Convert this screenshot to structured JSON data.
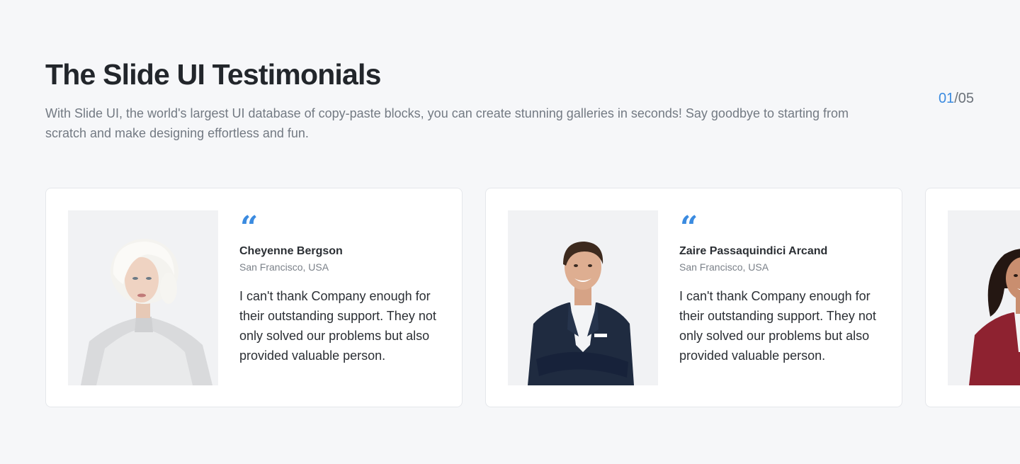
{
  "header": {
    "title": "The Slide UI Testimonials",
    "subtitle": "With Slide UI, the world's largest UI database of copy-paste blocks, you can create stunning galleries in seconds! Say goodbye to starting from scratch and make designing effortless and fun."
  },
  "pager": {
    "current": "01",
    "separator": "/",
    "total": "05"
  },
  "colors": {
    "accent": "#3b8be0",
    "background": "#f6f7f9",
    "card": "#ffffff"
  },
  "testimonials": [
    {
      "quote_icon": "“",
      "name": "Cheyenne Bergson",
      "location": "San Francisco, USA",
      "text": "I can't thank Company enough for their outstanding support. They not only solved our problems but also provided valuable person.",
      "photo": "woman-white-hair-portrait"
    },
    {
      "quote_icon": "“",
      "name": "Zaire Passaquindici Arcand",
      "location": "San Francisco, USA",
      "text": "I can't thank Company enough for their outstanding support. They not only solved our problems but also provided valuable person.",
      "photo": "man-navy-suit-portrait"
    },
    {
      "quote_icon": "“",
      "name": "",
      "location": "",
      "text": "",
      "photo": "woman-red-blazer-portrait"
    }
  ]
}
